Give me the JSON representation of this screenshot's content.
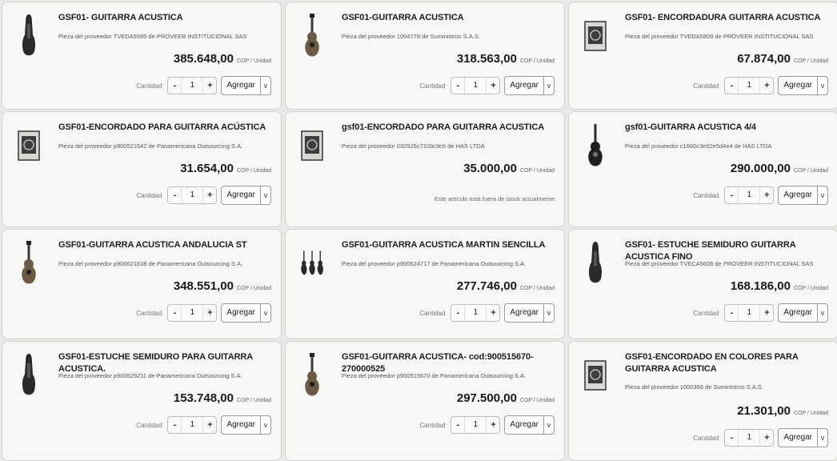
{
  "common": {
    "qty_label": "Cantidad",
    "qty_minus": "-",
    "qty_plus": "+",
    "qty_value": "1",
    "add_label": "Agregar",
    "add_caret": "v",
    "unit": "COP / Unidad"
  },
  "products": [
    {
      "title": "GSF01- GUITARRA ACUSTICA",
      "supplier": "Pieza del proveedor TVEDA5595 de PROVEER INSTITUCIONAL SAS",
      "price": "385.648,00",
      "thumb": "guitar-case-icon"
    },
    {
      "title": "GSF01-GUITARRA ACUSTICA",
      "supplier": "Pieza del proveedor 1004778 de Suministros S.A.S.",
      "price": "318.563,00",
      "thumb": "acoustic-guitar-icon"
    },
    {
      "title": "GSF01- ENCORDADURA GUITARRA ACUSTICA",
      "supplier": "Pieza del proveedor TVEDA5809 de PROVEER INSTITUCIONAL SAS",
      "price": "67.874,00",
      "thumb": "strings-package-icon"
    },
    {
      "title": "GSF01-ENCORDADO PARA GUITARRA ACÚSTICA",
      "supplier": "Pieza del proveedor p900521642 de Panamericana Outsourcing S.A.",
      "price": "31.654,00",
      "thumb": "strings-package-icon"
    },
    {
      "title": "gsf01-ENCORDADO PARA GUITARRA ACUSTICA",
      "supplier": "Pieza del proveedor 032926c7109c9c6 de HAS LTDA",
      "price": "35.000,00",
      "thumb": "strings-package-icon",
      "stock_note": "Este artículo está fuera de stock actualmente"
    },
    {
      "title": "gsf01-GUITARRA ACUSTICA 4/4",
      "supplier": "Pieza del proveedor c1660c3e02e5d4e4 de HAS LTDA",
      "price": "290.000,00",
      "thumb": "electro-acoustic-guitar-icon"
    },
    {
      "title": "GSF01-GUITARRA ACUSTICA ANDALUCIA ST",
      "supplier": "Pieza del proveedor p900621638 de Panamericana Outsourcing S.A.",
      "price": "348.551,00",
      "thumb": "acoustic-guitar-icon"
    },
    {
      "title": "GSF01-GUITARRA ACUSTICA MARTIN SENCILLA",
      "supplier": "Pieza del proveedor p900624717 de Panamericana Outsourcing S.A.",
      "price": "277.746,00",
      "thumb": "guitar-set-icon"
    },
    {
      "title": "GSF01- ESTUCHE SEMIDURO GUITARRA ACUSTICA FINO",
      "supplier": "Pieza del proveedor TVECA5608 de PROVEER INSTITUCIONAL SAS",
      "price": "168.186,00",
      "thumb": "guitar-case-icon"
    },
    {
      "title": "GSF01-ESTUCHE SEMIDURO PARA GUITARRA ACUSTICA.",
      "supplier": "Pieza del proveedor p900629211 de Panamericana Outsourcing S.A.",
      "price": "153.748,00",
      "thumb": "guitar-case-icon"
    },
    {
      "title": "GSF01-GUITARRA ACUSTICA- cod:900515670-270000525",
      "supplier": "Pieza del proveedor p900515670 de Panamericana Outsourcing S.A.",
      "price": "297.500,00",
      "thumb": "acoustic-guitar-icon"
    },
    {
      "title": "GSF01-ENCORDADO EN COLORES PARA GUITARRA ACUSTICA",
      "supplier": "Pieza del proveedor 1000366 de Suministros S.A.S.",
      "price": "21.301,00",
      "thumb": "strings-package-icon",
      "two_line": true
    }
  ]
}
